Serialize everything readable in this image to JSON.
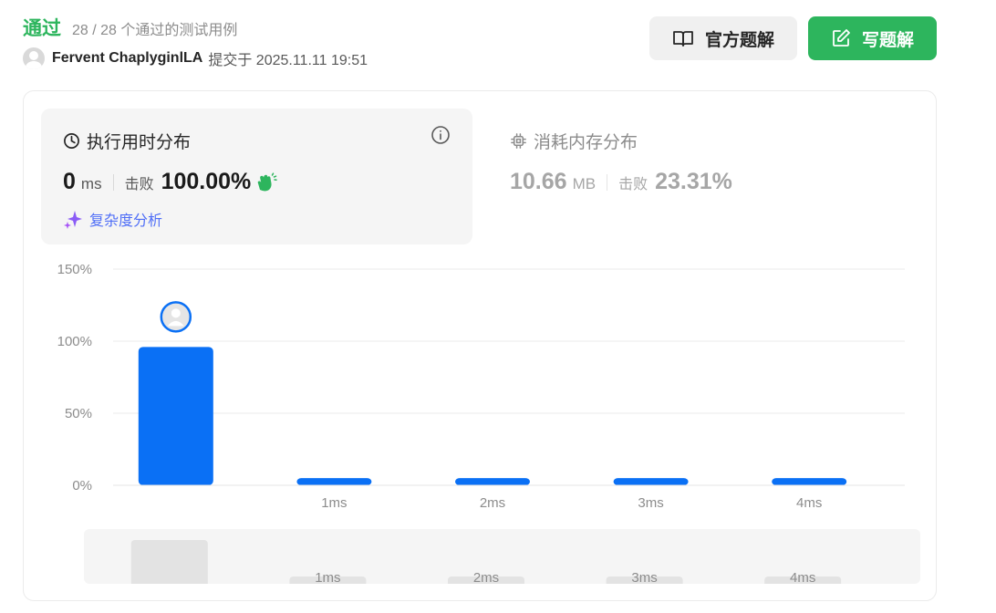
{
  "header": {
    "status": "通过",
    "test_count": "28 / 28 个通过的测试用例",
    "username": "Fervent ChaplyginlLA",
    "submit_time": "提交于 2025.11.11 19:51"
  },
  "actions": {
    "official_solution": "官方题解",
    "write_solution": "写题解"
  },
  "runtime": {
    "title": "执行用时分布",
    "value": "0",
    "unit": "ms",
    "beats_label": "击败",
    "beats_value": "100.00%",
    "complexity_link": "复杂度分析"
  },
  "memory": {
    "title": "消耗内存分布",
    "value": "10.66",
    "unit": "MB",
    "beats_label": "击败",
    "beats_value": "23.31%"
  },
  "colors": {
    "accent_green": "#2db55d",
    "bar_blue": "#0a70f5",
    "link_blue": "#4f6ef7"
  },
  "chart_data": {
    "type": "bar",
    "categories": [
      "0ms",
      "1ms",
      "2ms",
      "3ms",
      "4ms"
    ],
    "x_tick_labels": [
      "",
      "1ms",
      "2ms",
      "3ms",
      "4ms"
    ],
    "values": [
      96,
      5,
      5,
      5,
      5
    ],
    "y_ticks": [
      "0%",
      "50%",
      "100%",
      "150%"
    ],
    "y_tick_values": [
      0,
      50,
      100,
      150
    ],
    "ylim": [
      0,
      150
    ],
    "grid": true,
    "highlight_index": 0,
    "title": "",
    "xlabel": "",
    "ylabel": ""
  },
  "mini_map": {
    "values": [
      96,
      5,
      5,
      5,
      5
    ],
    "labels": [
      "",
      "1ms",
      "2ms",
      "3ms",
      "4ms"
    ]
  }
}
